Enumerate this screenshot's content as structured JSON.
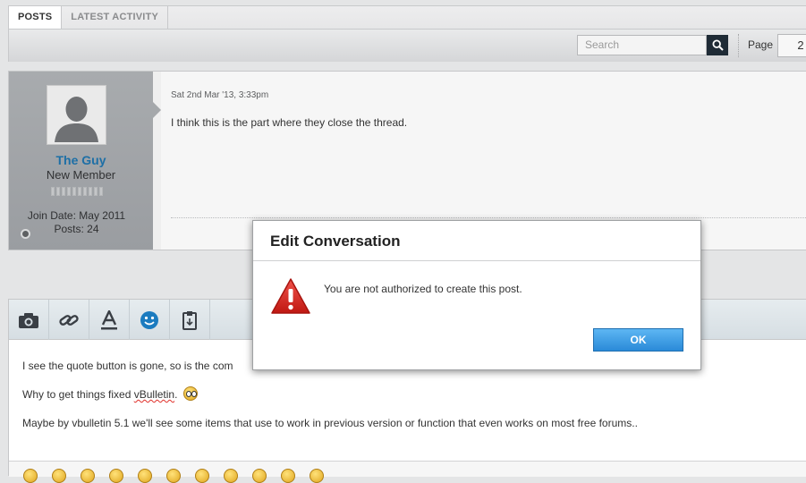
{
  "tabs": [
    {
      "label": "POSTS",
      "active": true
    },
    {
      "label": "LATEST ACTIVITY",
      "active": false
    }
  ],
  "toolbar": {
    "search_placeholder": "Search",
    "page_label": "Page",
    "page_value": "2"
  },
  "post": {
    "username": "The Guy",
    "user_title": "New Member",
    "join_date": "Join Date: May 2011",
    "posts": "Posts: 24",
    "date": "Sat 2nd Mar '13, 3:33pm",
    "text": "I think this is the part where they close the thread."
  },
  "editor": {
    "tools": [
      "camera-icon",
      "link-icon",
      "text-format-icon",
      "smiley-icon",
      "clipboard-icon"
    ],
    "line1": "I see the quote button is gone, so is the com",
    "line2_before": "Why to get things fixed ",
    "line2_word": "vBulletin",
    "line2_after": ".",
    "line3": "Maybe by vbulletin 5.1 we'll see some items that use to work in previous version or function that even works on most free forums.."
  },
  "dialog": {
    "title": "Edit Conversation",
    "message": "You are not authorized to create this post.",
    "ok_label": "OK",
    "icon": "warning-icon"
  },
  "colors": {
    "username": "#1d6fa6",
    "ok_button": "#2a8ad8",
    "warning": "#d8231c",
    "search_button": "#1f2b36"
  }
}
